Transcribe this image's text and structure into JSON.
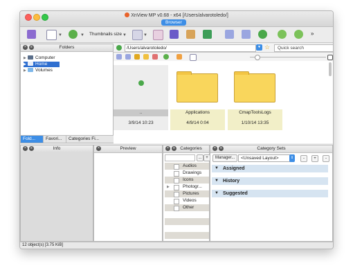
{
  "window": {
    "title": "XnView MP v0.68 - x64 [/Users/alvarotoledo/]",
    "active_tab": "Browser"
  },
  "toolbar": {
    "thumbnails_size_label": "Thumbnails size",
    "more_glyph": "»"
  },
  "folders_pane": {
    "title": "Folders",
    "tree": [
      {
        "label": "Computer",
        "icon": "computer-icon",
        "selected": false
      },
      {
        "label": "Home",
        "icon": "home-icon",
        "selected": true
      },
      {
        "label": "Volumes",
        "icon": "folder-icon",
        "selected": false
      }
    ],
    "tabs": [
      "Fold...",
      "Favori...",
      "Categories Fi..."
    ],
    "active_tab_index": 0
  },
  "address": {
    "path": "/Users/alvarotoledo/",
    "search_placeholder": "Quick search"
  },
  "browser": {
    "items": [
      {
        "name": "..",
        "date": "3/9/14 10:23",
        "type": "parent-up"
      },
      {
        "name": "Applications",
        "date": "4/9/14 0:04",
        "type": "folder"
      },
      {
        "name": "CmapToolsLogs",
        "date": "1/10/14 13:35",
        "type": "folder"
      }
    ]
  },
  "info_pane": {
    "title": "Info"
  },
  "preview_pane": {
    "title": "Preview"
  },
  "categories_pane": {
    "title": "Categories",
    "items": [
      "Audios",
      "Drawings",
      "Icons",
      "Photogr...",
      "Pictures",
      "Videos",
      "Other"
    ],
    "buttons": [
      "...",
      "+"
    ]
  },
  "category_sets_pane": {
    "title": "Category Sets",
    "manager_label": "Manager...",
    "layout_value": "<Unsaved Layout>",
    "buttons": [
      "-",
      "+",
      "-"
    ],
    "sections": [
      "Assigned",
      "History",
      "Suggested"
    ]
  },
  "status": {
    "text": "12 object(s) [3.75 KiB]"
  },
  "colors": {
    "accent": "#3d8ee6",
    "selection": "#2f6fd0",
    "folder": "#f9d65c",
    "section_bg": "#d6e4f1"
  }
}
